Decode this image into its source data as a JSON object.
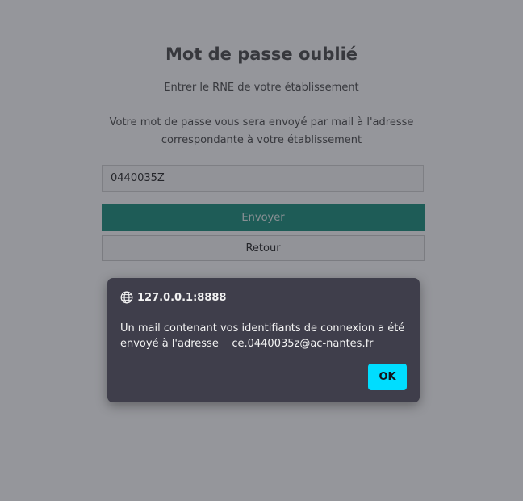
{
  "page": {
    "title": "Mot de passe oublié",
    "subtitle": "Entrer le RNE de votre établissement",
    "info_line1": "Votre mot de passe vous sera envoyé par mail à l'adresse",
    "info_line2": "correspondante à votre établissement",
    "rne_value": "0440035Z",
    "send_label": "Envoyer",
    "back_label": "Retour"
  },
  "dialog": {
    "origin": "127.0.0.1:8888",
    "message": "Un mail contenant vos identifiants de connexion a été envoyé à l'adresse    ce.0440035z@ac-nantes.fr",
    "ok_label": "OK"
  },
  "colors": {
    "send_button": "#279684",
    "dialog_bg": "#3f3e4b",
    "ok_button": "#00ddff"
  }
}
